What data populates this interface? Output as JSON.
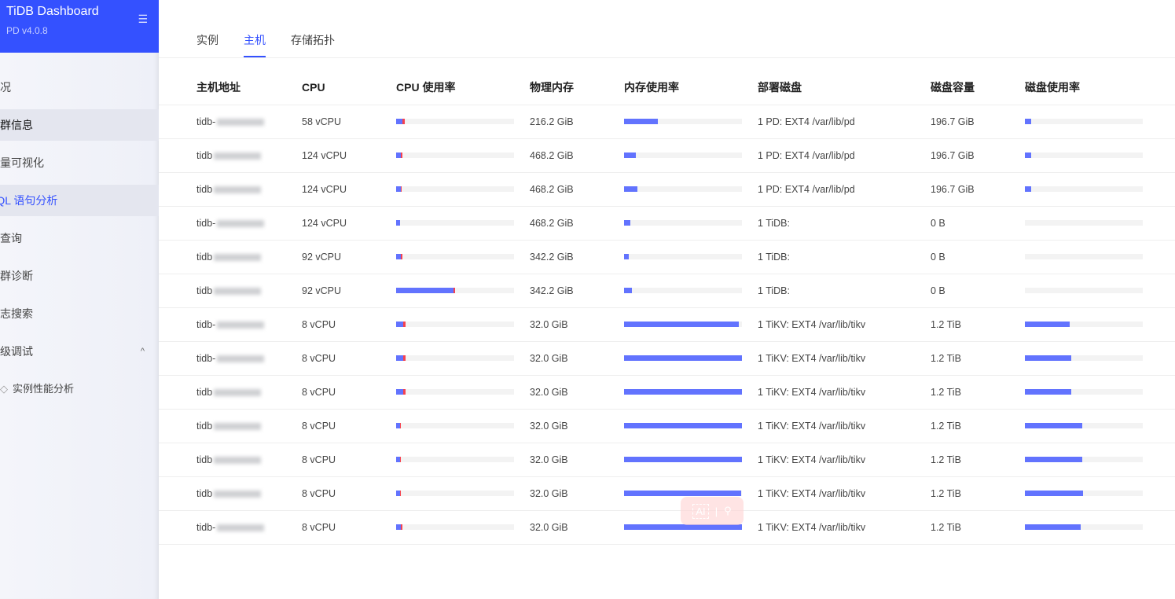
{
  "app": {
    "title": "TiDB Dashboard",
    "version": "PD v4.0.8"
  },
  "sidebar": {
    "items": [
      {
        "label": "概况"
      },
      {
        "label": "集群信息"
      },
      {
        "label": "流量可视化"
      },
      {
        "label": "SQL 语句分析"
      },
      {
        "label": "慢查询"
      },
      {
        "label": "集群诊断"
      },
      {
        "label": "日志搜索"
      },
      {
        "label": "高级调试"
      },
      {
        "label": "实例性能分析"
      }
    ]
  },
  "tabs": [
    {
      "label": "实例"
    },
    {
      "label": "主机"
    },
    {
      "label": "存储拓扑"
    }
  ],
  "table": {
    "headers": [
      "主机地址",
      "CPU",
      "CPU 使用率",
      "物理内存",
      "内存使用率",
      "部署磁盘",
      "磁盘容量",
      "磁盘使用率"
    ],
    "rows": [
      {
        "host": "tidb-",
        "cpu": "58 vCPU",
        "cpu_user": 5.3,
        "cpu_sys": 2,
        "mem": "216.2 GiB",
        "mem_pct": 28.7,
        "disk": "1 PD: EXT4 /var/lib/pd",
        "cap": "196.7 GiB",
        "disk_pct": 5
      },
      {
        "host": "tidb",
        "cpu": "124 vCPU",
        "cpu_user": 4,
        "cpu_sys": 1.3,
        "mem": "468.2 GiB",
        "mem_pct": 10,
        "disk": "1 PD: EXT4 /var/lib/pd",
        "cap": "196.7 GiB",
        "disk_pct": 5
      },
      {
        "host": "tidb",
        "cpu": "124 vCPU",
        "cpu_user": 4,
        "cpu_sys": 0.5,
        "mem": "468.2 GiB",
        "mem_pct": 11.3,
        "disk": "1 PD: EXT4 /var/lib/pd",
        "cap": "196.7 GiB",
        "disk_pct": 5
      },
      {
        "host": "tidb-",
        "cpu": "124 vCPU",
        "cpu_user": 3.5,
        "cpu_sys": 0,
        "mem": "468.2 GiB",
        "mem_pct": 5.3,
        "disk": "1 TiDB:",
        "cap": "0 B",
        "disk_pct": 0
      },
      {
        "host": "tidb",
        "cpu": "92 vCPU",
        "cpu_user": 4,
        "cpu_sys": 1.3,
        "mem": "342.2 GiB",
        "mem_pct": 4,
        "disk": "1 TiDB:",
        "cap": "0 B",
        "disk_pct": 0
      },
      {
        "host": "tidb",
        "cpu": "92 vCPU",
        "cpu_user": 48.7,
        "cpu_sys": 1.3,
        "mem": "342.2 GiB",
        "mem_pct": 6.7,
        "disk": "1 TiDB:",
        "cap": "0 B",
        "disk_pct": 0
      },
      {
        "host": "tidb-",
        "cpu": "8 vCPU",
        "cpu_user": 6,
        "cpu_sys": 2,
        "mem": "32.0 GiB",
        "mem_pct": 97,
        "disk": "1 TiKV: EXT4 /var/lib/tikv",
        "cap": "1.2 TiB",
        "disk_pct": 38
      },
      {
        "host": "tidb-",
        "cpu": "8 vCPU",
        "cpu_user": 6,
        "cpu_sys": 2,
        "mem": "32.0 GiB",
        "mem_pct": 100,
        "disk": "1 TiKV: EXT4 /var/lib/tikv",
        "cap": "1.2 TiB",
        "disk_pct": 39
      },
      {
        "host": "tidb",
        "cpu": "8 vCPU",
        "cpu_user": 6,
        "cpu_sys": 2,
        "mem": "32.0 GiB",
        "mem_pct": 100,
        "disk": "1 TiKV: EXT4 /var/lib/tikv",
        "cap": "1.2 TiB",
        "disk_pct": 39
      },
      {
        "host": "tidb",
        "cpu": "8 vCPU",
        "cpu_user": 3.5,
        "cpu_sys": 0.5,
        "mem": "32.0 GiB",
        "mem_pct": 100,
        "disk": "1 TiKV: EXT4 /var/lib/tikv",
        "cap": "1.2 TiB",
        "disk_pct": 48.7
      },
      {
        "host": "tidb",
        "cpu": "8 vCPU",
        "cpu_user": 3.5,
        "cpu_sys": 0.5,
        "mem": "32.0 GiB",
        "mem_pct": 100,
        "disk": "1 TiKV: EXT4 /var/lib/tikv",
        "cap": "1.2 TiB",
        "disk_pct": 48.7
      },
      {
        "host": "tidb",
        "cpu": "8 vCPU",
        "cpu_user": 3.5,
        "cpu_sys": 0.5,
        "mem": "32.0 GiB",
        "mem_pct": 99,
        "disk": "1 TiKV: EXT4 /var/lib/tikv",
        "cap": "1.2 TiB",
        "disk_pct": 49.3
      },
      {
        "host": "tidb-",
        "cpu": "8 vCPU",
        "cpu_user": 4,
        "cpu_sys": 1,
        "mem": "32.0 GiB",
        "mem_pct": 100,
        "disk": "1 TiKV: EXT4 /var/lib/tikv",
        "cap": "1.2 TiB",
        "disk_pct": 47.3
      }
    ]
  },
  "overlay": {
    "ai_label": "AI"
  }
}
